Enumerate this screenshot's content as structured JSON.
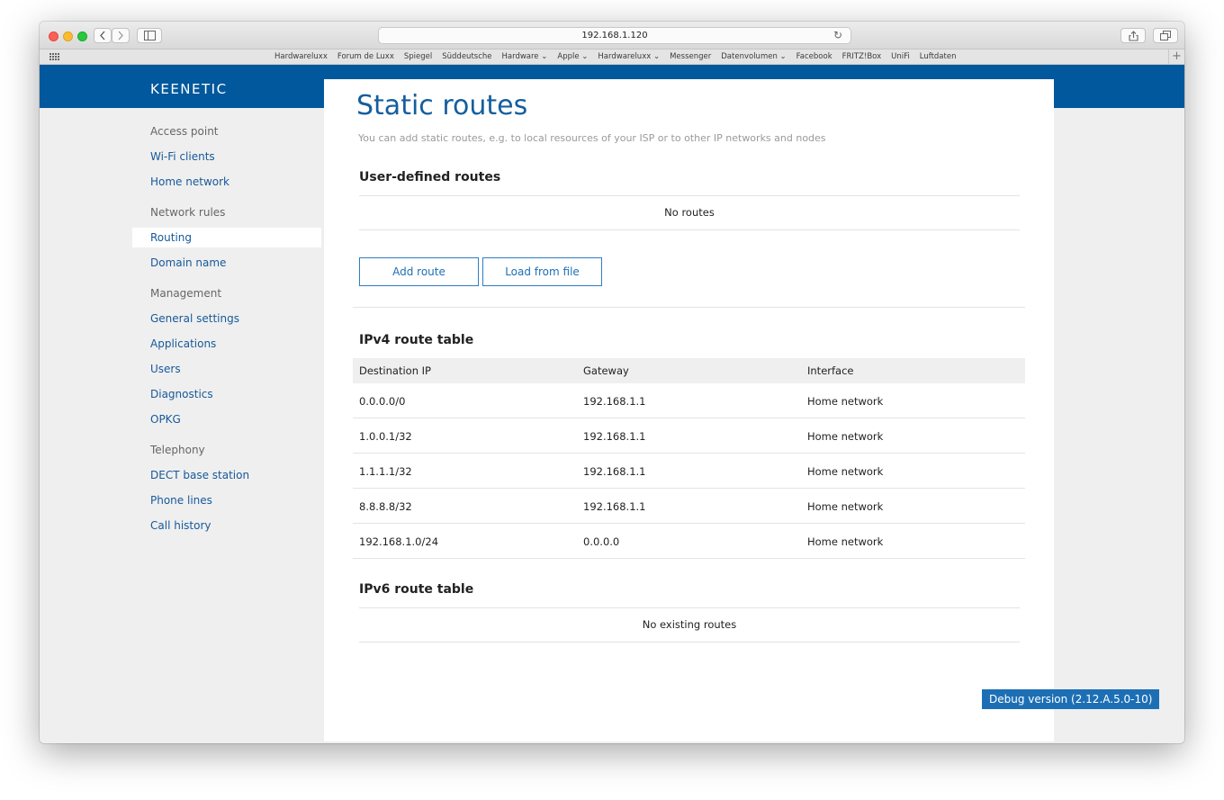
{
  "browser": {
    "url": "192.168.1.120",
    "bookmarks": [
      "Hardwareluxx",
      "Forum de Luxx",
      "Spiegel",
      "Süddeutsche",
      "Hardware ⌄",
      "Apple ⌄",
      "Hardwareluxx ⌄",
      "Messenger",
      "Datenvolumen ⌄",
      "Facebook",
      "FRITZ!Box",
      "UniFi",
      "Luftdaten"
    ],
    "icons": {
      "back": "chevron-left-icon",
      "forward": "chevron-right-icon",
      "sidebar": "sidebar-icon",
      "reload": "reload-icon",
      "share": "share-icon",
      "tabs": "tabs-icon",
      "bookmarks_grid": "grid-icon",
      "new_tab": "plus-icon"
    }
  },
  "app": {
    "logo": "KEENETIC",
    "brand_color": "#02589c",
    "accent_color": "#1d6fb5"
  },
  "sidebar": {
    "sections": [
      {
        "title": "Access point",
        "items": [
          "Wi-Fi clients",
          "Home network"
        ]
      },
      {
        "title": "Network rules",
        "items": [
          "Routing",
          "Domain name"
        ]
      },
      {
        "title": "Management",
        "items": [
          "General settings",
          "Applications",
          "Users",
          "Diagnostics",
          "OPKG"
        ]
      },
      {
        "title": "Telephony",
        "items": [
          "DECT base station",
          "Phone lines",
          "Call history"
        ]
      }
    ],
    "active_item": "Routing"
  },
  "main": {
    "title": "Static routes",
    "subtitle": "You can add static routes, e.g. to local resources of your ISP or to other IP networks and nodes",
    "user_routes": {
      "title": "User-defined routes",
      "empty_message": "No routes"
    },
    "buttons": {
      "add_route": "Add route",
      "load_from_file": "Load from file"
    },
    "ipv4": {
      "title": "IPv4 route table",
      "columns": [
        "Destination IP",
        "Gateway",
        "Interface"
      ],
      "rows": [
        [
          "0.0.0.0/0",
          "192.168.1.1",
          "Home network"
        ],
        [
          "1.0.0.1/32",
          "192.168.1.1",
          "Home network"
        ],
        [
          "1.1.1.1/32",
          "192.168.1.1",
          "Home network"
        ],
        [
          "8.8.8.8/32",
          "192.168.1.1",
          "Home network"
        ],
        [
          "192.168.1.0/24",
          "0.0.0.0",
          "Home network"
        ]
      ]
    },
    "ipv6": {
      "title": "IPv6 route table",
      "empty_message": "No existing routes"
    }
  },
  "debug": {
    "label": "Debug version (2.12.A.5.0-10)"
  }
}
